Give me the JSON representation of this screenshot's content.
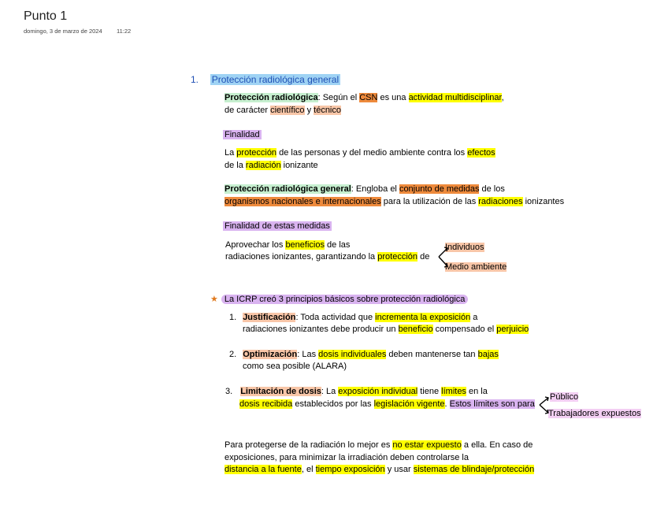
{
  "page": {
    "title": "Punto 1",
    "date": "domingo, 3 de marzo de 2024",
    "time": "11:22"
  },
  "section": {
    "number": "1.",
    "heading": "Protección radiológica general"
  },
  "def1": {
    "term": "Protección radiológica",
    "t1": ": Según el ",
    "csn": "CSN",
    "t2": " es una ",
    "activity": "actividad multidisciplinar",
    "t3": ",",
    "t4": "de carácter ",
    "scientific": "científico",
    "t5": " y ",
    "technical": "técnico"
  },
  "finalidad": {
    "label": "Finalidad",
    "t1": "La ",
    "protection": "protección",
    "t2": " de las personas y del medio ambiente contra los ",
    "effects": "efectos",
    "t3": "de la ",
    "radiation": "radiación",
    "t4": " ionizante"
  },
  "def2": {
    "term": "Protección radiológica general",
    "t1": ": Engloba el ",
    "measures": "conjunto de medidas",
    "t2": " de los",
    "orgs": "organismos nacionales e internacionales",
    "t3": " para la utilización de las ",
    "radiations": "radiaciones",
    "t4": " ionizantes"
  },
  "finalidad_medidas": {
    "label": "Finalidad de estas medidas",
    "t1": "Aprovechar los ",
    "benefits": "beneficios",
    "t2": " de las",
    "t3": " radiaciones ionizantes, garantizando la ",
    "protection": "protección",
    "t4": " de",
    "branch1": "Individuos",
    "branch2": "Medio ambiente"
  },
  "icrp": {
    "star": "★",
    "label": "La ICRP creó 3 principios básicos sobre protección radiológica"
  },
  "principles": [
    {
      "num": "1.",
      "term": "Justificación",
      "t1": ": Toda actividad que ",
      "k1": "incrementa la exposición",
      "t2": " a",
      "t3": "radiaciones ionizantes debe producir un ",
      "k2": "beneficio",
      "t4": " compensado el ",
      "k3": "perjuicio"
    },
    {
      "num": "2.",
      "term": "Optimización",
      "t1": ": Las ",
      "k1": "dosis individuales",
      "t2": " deben mantenerse tan ",
      "k2": "bajas",
      "t3": "como sea posible (ALARA)"
    },
    {
      "num": "3.",
      "term": "Limitación de dosis",
      "t1": ": La ",
      "k1": "exposición individual",
      "t2": " tiene ",
      "k2": "límites",
      "t3": " en la",
      "k3": "dosis recibida",
      "t4": " establecidos por las ",
      "k4": "legislación vigente",
      "t5": ". ",
      "k5": "Estos límites son para",
      "branch1": "Público",
      "branch2": "Trabajadores expuestos"
    }
  ],
  "closing": {
    "t1": "Para protegerse de la radiación lo mejor es ",
    "k1": "no estar expuesto",
    "t2": " a ella. En caso de",
    "t3": "exposiciones, para minimizar la irradiación deben controlarse la",
    "k2": "distancia a la fuente",
    "t4": ", el ",
    "k3": "tiempo exposición",
    "t5": " y usar ",
    "k4": "sistemas de blindaje/protección"
  }
}
